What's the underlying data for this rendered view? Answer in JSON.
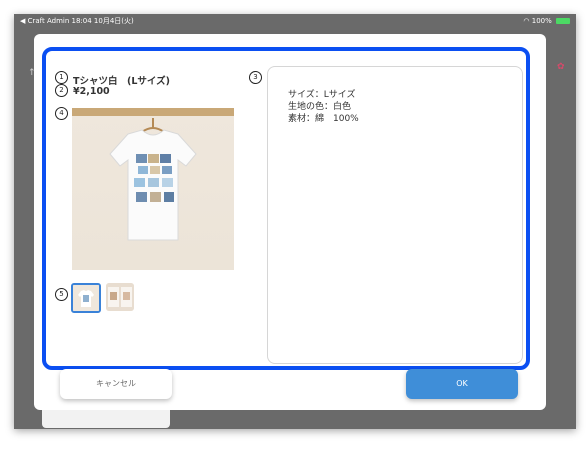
{
  "status_bar": {
    "left": "◀ Craft Admin  18:04  10月4日(火)",
    "right": "100%",
    "icons": [
      "wifi-icon",
      "battery-icon"
    ],
    "battery_color": "#4cd964"
  },
  "callouts": [
    "1",
    "2",
    "3",
    "4",
    "5"
  ],
  "product": {
    "title": "Tシャツ白　(Lサイズ)",
    "price": "¥2,100"
  },
  "description_lines": [
    "サイズ：Lサイズ",
    "生地の色：白色",
    "素材：綿　100%"
  ],
  "buttons": {
    "cancel": "キャンセル",
    "ok": "OK"
  },
  "colors": {
    "frame_border": "#0b4ff2",
    "ok_button": "#3f8ed8",
    "thumb_selected_border": "#3a82d8"
  }
}
